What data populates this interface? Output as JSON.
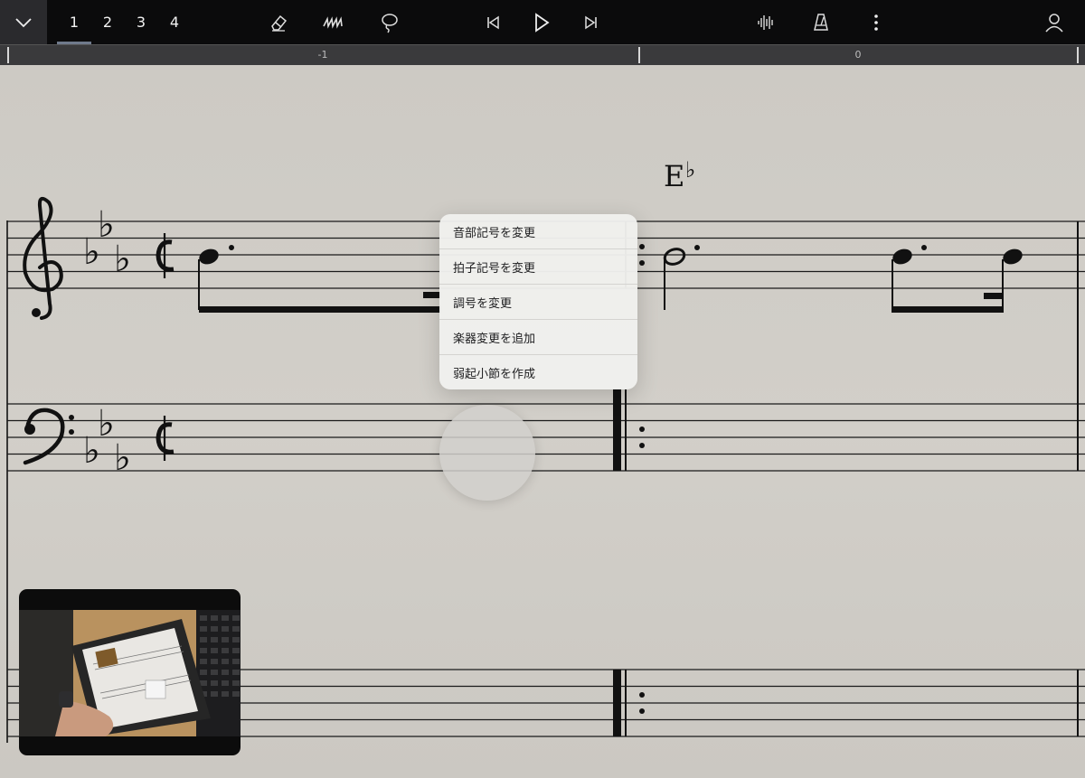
{
  "toolbar": {
    "page_tabs": [
      "1",
      "2",
      "3",
      "4"
    ],
    "active_tab": "1",
    "icons": [
      "chevron-down-icon",
      "eraser-icon",
      "pen-scribble-icon",
      "lasso-icon",
      "skip-back-icon",
      "play-icon",
      "skip-forward-icon",
      "audio-waveform-icon",
      "metronome-icon",
      "more-vertical-icon",
      "user-icon"
    ]
  },
  "ruler": {
    "labels": [
      "-1",
      "0"
    ]
  },
  "score": {
    "chord_root": "E",
    "chord_accidental": "♭",
    "time_signature": "cut-time",
    "key_signature": "three flats"
  },
  "context_menu": {
    "items": [
      "音部記号を変更",
      "拍子記号を変更",
      "調号を変更",
      "楽器変更を追加",
      "弱起小節を作成"
    ]
  },
  "colors": {
    "toolbar_bg": "#0b0b0c",
    "ruler_bg": "#3a3a3c",
    "paper_bg": "#cfccc6",
    "menu_bg": "#f0efed",
    "active_tab_underline": "#6f7a8c"
  }
}
